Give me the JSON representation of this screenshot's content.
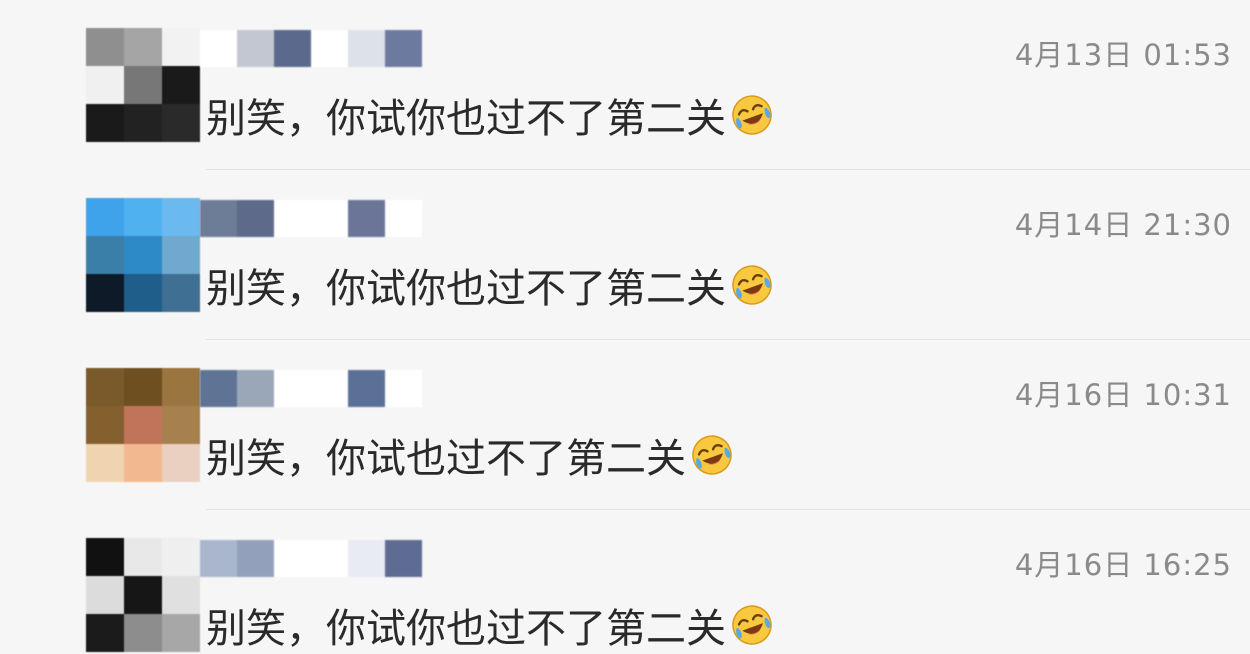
{
  "chats": [
    {
      "time": "4月13日 01:53",
      "message": "别笑，你试你也过不了第二关",
      "emoji_icon": "face-with-tears-of-joy-icon",
      "avatar_colors": [
        "#8f8f8f",
        "#a5a5a5",
        "#f2f2f2",
        "#f0f0f0",
        "#777777",
        "#1a1a1a",
        "#1a1a1a",
        "#222222",
        "#2a2a2a"
      ],
      "name_colors": [
        "#ffffff",
        "#c2c7d2",
        "#5b6a8c",
        "#ffffff",
        "#dde1ea",
        "#6d7aa0"
      ]
    },
    {
      "time": "4月14日 21:30",
      "message": "别笑，你试你也过不了第二关",
      "emoji_icon": "face-with-tears-of-joy-icon",
      "avatar_colors": [
        "#3ea3ea",
        "#4fb1f0",
        "#6ab9ef",
        "#3a7fa8",
        "#2e8ac6",
        "#6fa9cf",
        "#0e1a28",
        "#1f5d8a",
        "#3f6f92"
      ],
      "name_colors": [
        "#6d7c97",
        "#5d6a89",
        "#ffffff",
        "#ffffff",
        "#6b7598",
        "#ffffff"
      ]
    },
    {
      "time": "4月16日 10:31",
      "message": "别笑，你试也过不了第二关",
      "emoji_icon": "face-with-tears-of-joy-icon",
      "avatar_colors": [
        "#7a5a2a",
        "#6e4f20",
        "#9a7540",
        "#84602e",
        "#c0755a",
        "#a6814e",
        "#f0d4b0",
        "#f2b890",
        "#e9d0c0"
      ],
      "name_colors": [
        "#5f7394",
        "#9aa7b8",
        "#ffffff",
        "#ffffff",
        "#5a7096",
        "#ffffff"
      ]
    },
    {
      "time": "4月16日 16:25",
      "message": "别笑，你试你也过不了第二关",
      "emoji_icon": "face-with-tears-of-joy-icon",
      "avatar_colors": [
        "#111111",
        "#e8e8e8",
        "#efefef",
        "#dcdcdc",
        "#161616",
        "#e0e0e0",
        "#1b1b1b",
        "#8d8d8d",
        "#a7a7a7"
      ],
      "name_colors": [
        "#a9b6cc",
        "#93a0bc",
        "#ffffff",
        "#ffffff",
        "#e8ebf2",
        "#5e6b92"
      ]
    }
  ]
}
